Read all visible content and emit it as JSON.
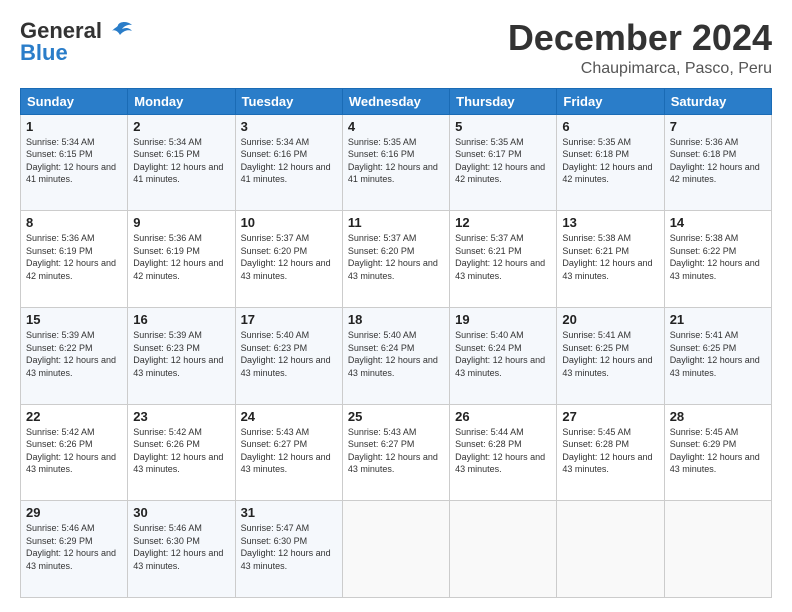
{
  "header": {
    "logo_general": "General",
    "logo_blue": "Blue",
    "month": "December 2024",
    "location": "Chaupimarca, Pasco, Peru"
  },
  "weekdays": [
    "Sunday",
    "Monday",
    "Tuesday",
    "Wednesday",
    "Thursday",
    "Friday",
    "Saturday"
  ],
  "weeks": [
    [
      {
        "day": "1",
        "sunrise": "Sunrise: 5:34 AM",
        "sunset": "Sunset: 6:15 PM",
        "daylight": "Daylight: 12 hours and 41 minutes."
      },
      {
        "day": "2",
        "sunrise": "Sunrise: 5:34 AM",
        "sunset": "Sunset: 6:15 PM",
        "daylight": "Daylight: 12 hours and 41 minutes."
      },
      {
        "day": "3",
        "sunrise": "Sunrise: 5:34 AM",
        "sunset": "Sunset: 6:16 PM",
        "daylight": "Daylight: 12 hours and 41 minutes."
      },
      {
        "day": "4",
        "sunrise": "Sunrise: 5:35 AM",
        "sunset": "Sunset: 6:16 PM",
        "daylight": "Daylight: 12 hours and 41 minutes."
      },
      {
        "day": "5",
        "sunrise": "Sunrise: 5:35 AM",
        "sunset": "Sunset: 6:17 PM",
        "daylight": "Daylight: 12 hours and 42 minutes."
      },
      {
        "day": "6",
        "sunrise": "Sunrise: 5:35 AM",
        "sunset": "Sunset: 6:18 PM",
        "daylight": "Daylight: 12 hours and 42 minutes."
      },
      {
        "day": "7",
        "sunrise": "Sunrise: 5:36 AM",
        "sunset": "Sunset: 6:18 PM",
        "daylight": "Daylight: 12 hours and 42 minutes."
      }
    ],
    [
      {
        "day": "8",
        "sunrise": "Sunrise: 5:36 AM",
        "sunset": "Sunset: 6:19 PM",
        "daylight": "Daylight: 12 hours and 42 minutes."
      },
      {
        "day": "9",
        "sunrise": "Sunrise: 5:36 AM",
        "sunset": "Sunset: 6:19 PM",
        "daylight": "Daylight: 12 hours and 42 minutes."
      },
      {
        "day": "10",
        "sunrise": "Sunrise: 5:37 AM",
        "sunset": "Sunset: 6:20 PM",
        "daylight": "Daylight: 12 hours and 43 minutes."
      },
      {
        "day": "11",
        "sunrise": "Sunrise: 5:37 AM",
        "sunset": "Sunset: 6:20 PM",
        "daylight": "Daylight: 12 hours and 43 minutes."
      },
      {
        "day": "12",
        "sunrise": "Sunrise: 5:37 AM",
        "sunset": "Sunset: 6:21 PM",
        "daylight": "Daylight: 12 hours and 43 minutes."
      },
      {
        "day": "13",
        "sunrise": "Sunrise: 5:38 AM",
        "sunset": "Sunset: 6:21 PM",
        "daylight": "Daylight: 12 hours and 43 minutes."
      },
      {
        "day": "14",
        "sunrise": "Sunrise: 5:38 AM",
        "sunset": "Sunset: 6:22 PM",
        "daylight": "Daylight: 12 hours and 43 minutes."
      }
    ],
    [
      {
        "day": "15",
        "sunrise": "Sunrise: 5:39 AM",
        "sunset": "Sunset: 6:22 PM",
        "daylight": "Daylight: 12 hours and 43 minutes."
      },
      {
        "day": "16",
        "sunrise": "Sunrise: 5:39 AM",
        "sunset": "Sunset: 6:23 PM",
        "daylight": "Daylight: 12 hours and 43 minutes."
      },
      {
        "day": "17",
        "sunrise": "Sunrise: 5:40 AM",
        "sunset": "Sunset: 6:23 PM",
        "daylight": "Daylight: 12 hours and 43 minutes."
      },
      {
        "day": "18",
        "sunrise": "Sunrise: 5:40 AM",
        "sunset": "Sunset: 6:24 PM",
        "daylight": "Daylight: 12 hours and 43 minutes."
      },
      {
        "day": "19",
        "sunrise": "Sunrise: 5:40 AM",
        "sunset": "Sunset: 6:24 PM",
        "daylight": "Daylight: 12 hours and 43 minutes."
      },
      {
        "day": "20",
        "sunrise": "Sunrise: 5:41 AM",
        "sunset": "Sunset: 6:25 PM",
        "daylight": "Daylight: 12 hours and 43 minutes."
      },
      {
        "day": "21",
        "sunrise": "Sunrise: 5:41 AM",
        "sunset": "Sunset: 6:25 PM",
        "daylight": "Daylight: 12 hours and 43 minutes."
      }
    ],
    [
      {
        "day": "22",
        "sunrise": "Sunrise: 5:42 AM",
        "sunset": "Sunset: 6:26 PM",
        "daylight": "Daylight: 12 hours and 43 minutes."
      },
      {
        "day": "23",
        "sunrise": "Sunrise: 5:42 AM",
        "sunset": "Sunset: 6:26 PM",
        "daylight": "Daylight: 12 hours and 43 minutes."
      },
      {
        "day": "24",
        "sunrise": "Sunrise: 5:43 AM",
        "sunset": "Sunset: 6:27 PM",
        "daylight": "Daylight: 12 hours and 43 minutes."
      },
      {
        "day": "25",
        "sunrise": "Sunrise: 5:43 AM",
        "sunset": "Sunset: 6:27 PM",
        "daylight": "Daylight: 12 hours and 43 minutes."
      },
      {
        "day": "26",
        "sunrise": "Sunrise: 5:44 AM",
        "sunset": "Sunset: 6:28 PM",
        "daylight": "Daylight: 12 hours and 43 minutes."
      },
      {
        "day": "27",
        "sunrise": "Sunrise: 5:45 AM",
        "sunset": "Sunset: 6:28 PM",
        "daylight": "Daylight: 12 hours and 43 minutes."
      },
      {
        "day": "28",
        "sunrise": "Sunrise: 5:45 AM",
        "sunset": "Sunset: 6:29 PM",
        "daylight": "Daylight: 12 hours and 43 minutes."
      }
    ],
    [
      {
        "day": "29",
        "sunrise": "Sunrise: 5:46 AM",
        "sunset": "Sunset: 6:29 PM",
        "daylight": "Daylight: 12 hours and 43 minutes."
      },
      {
        "day": "30",
        "sunrise": "Sunrise: 5:46 AM",
        "sunset": "Sunset: 6:30 PM",
        "daylight": "Daylight: 12 hours and 43 minutes."
      },
      {
        "day": "31",
        "sunrise": "Sunrise: 5:47 AM",
        "sunset": "Sunset: 6:30 PM",
        "daylight": "Daylight: 12 hours and 43 minutes."
      },
      null,
      null,
      null,
      null
    ]
  ]
}
